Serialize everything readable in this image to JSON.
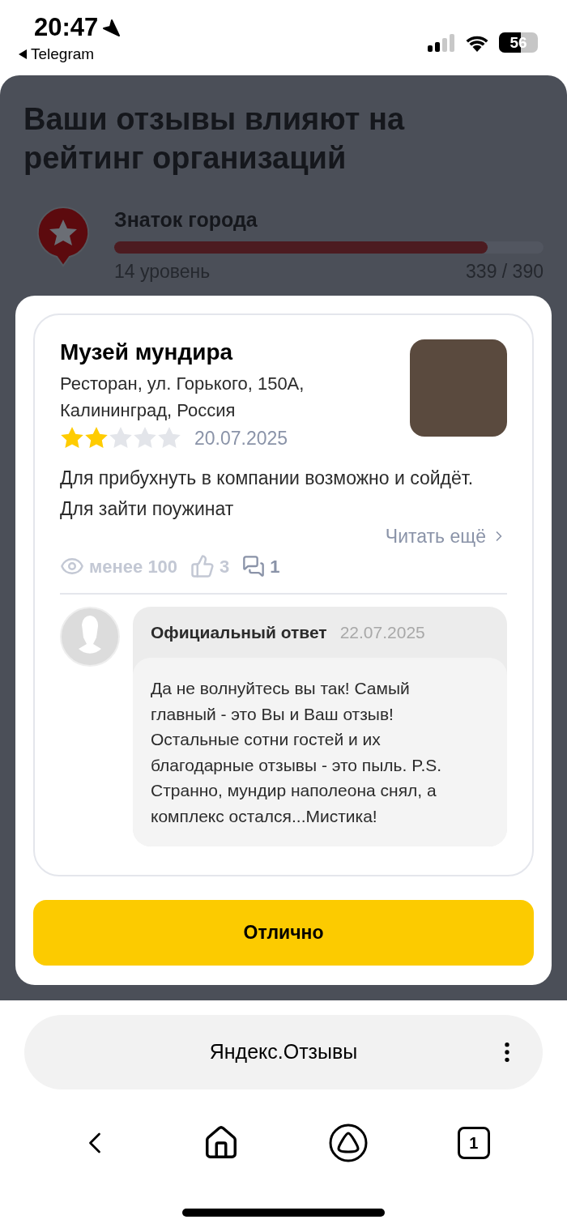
{
  "status_bar": {
    "time": "20:47",
    "back_app": "Telegram",
    "battery": "56"
  },
  "page": {
    "title": "Ваши отзывы влияют на рейтинг организаций",
    "badge": {
      "name": "Знаток города",
      "level": 0.87,
      "rank": "14 уровень",
      "points": "339 / 390"
    }
  },
  "dialog": {
    "review": {
      "place": "Музей мундира",
      "address": "Ресторан, ул. Горького, 150А, Калининград, Россия",
      "stars": 2,
      "date": "20.07.2025",
      "text": "Для прибухнуть в компании возможно и сойдёт. Для зайти поужинат",
      "read_more": "Читать ещё",
      "views": "менее 100",
      "likes": "3",
      "comments": "1"
    },
    "reply": {
      "author": "Официальный ответ",
      "date": "22.07.2025",
      "text": "Да не волнуйтесь вы так! Самый главный - это Вы и Ваш отзыв! Остальные сотни гостей и их благодарные отзывы - это пыль. P.S. Странно, мундир наполеона снял, а комплекс остался...Мистика!"
    },
    "button": "Отлично"
  },
  "browser": {
    "address": "Яндекс.Отзывы",
    "tabs_count": "1"
  }
}
